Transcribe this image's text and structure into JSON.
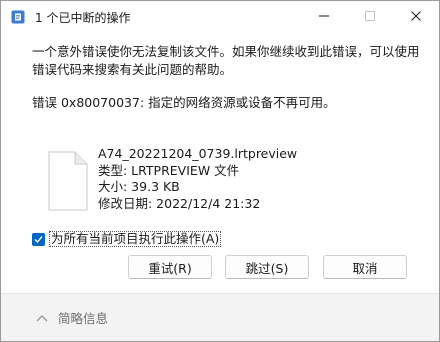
{
  "window": {
    "title": "1 个已中断的操作"
  },
  "message": {
    "primary": "一个意外错误使你无法复制该文件。如果你继续收到此错误，可以使用错误代码来搜索有关此问题的帮助。",
    "error": "错误 0x80070037: 指定的网络资源或设备不再可用。"
  },
  "file": {
    "name": "A74_20221204_0739.lrtpreview",
    "type": "类型: LRTPREVIEW 文件",
    "size": "大小: 39.3 KB",
    "modified": "修改日期: 2022/12/4 21:32"
  },
  "apply_all": {
    "label": "为所有当前项目执行此操作(A)",
    "checked": true
  },
  "buttons": {
    "retry": "重试(R)",
    "skip": "跳过(S)",
    "cancel": "取消"
  },
  "footer": {
    "details_label": "简略信息"
  },
  "colors": {
    "accent": "#0067c0",
    "footer_bg": "#f3f3f3"
  },
  "icons": {
    "app": "warning-folder-icon",
    "file": "blank-file-icon",
    "details": "chevron-up-icon"
  }
}
